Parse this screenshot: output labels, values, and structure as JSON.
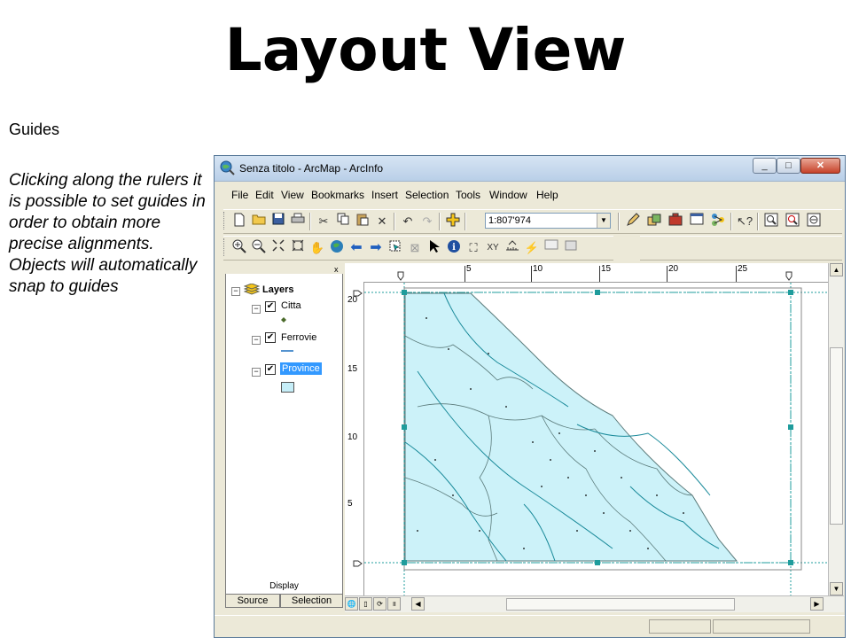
{
  "slide": {
    "title": "Layout View",
    "heading": "Guides",
    "description": "Clicking along the rulers it is possible to set guides in order to obtain more precise alignments. Objects will automatically snap to guides"
  },
  "window": {
    "title": "Senza titolo - ArcMap - ArcInfo",
    "minimize": "_",
    "maximize": "□",
    "close": "✕"
  },
  "menu": [
    "File",
    "Edit",
    "View",
    "Bookmarks",
    "Insert",
    "Selection",
    "Tools",
    "Window",
    "Help"
  ],
  "toolbar": {
    "scale": "1:807'974"
  },
  "toc": {
    "close": "x",
    "root": "Layers",
    "layers": [
      {
        "name": "Citta",
        "checked": true
      },
      {
        "name": "Ferrovie",
        "checked": true
      },
      {
        "name": "Province",
        "checked": true,
        "selected": true
      }
    ],
    "display_tab": "Display",
    "tabs": [
      "Source",
      "Selection"
    ]
  },
  "rulers": {
    "top": [
      "5",
      "10",
      "15",
      "20",
      "25"
    ],
    "left": [
      "20",
      "15",
      "10",
      "5"
    ]
  },
  "colors": {
    "map_fill": "#ccf2f9",
    "boundary": "#5a7a7a",
    "rivers": "#1a8a9a",
    "selection": "#1f9c9c",
    "province_swatch": "#c6eef8"
  },
  "icons": {
    "toc_toolbar": [
      "map-icon",
      "document-icon",
      "refresh-icon",
      "pause-icon"
    ]
  }
}
